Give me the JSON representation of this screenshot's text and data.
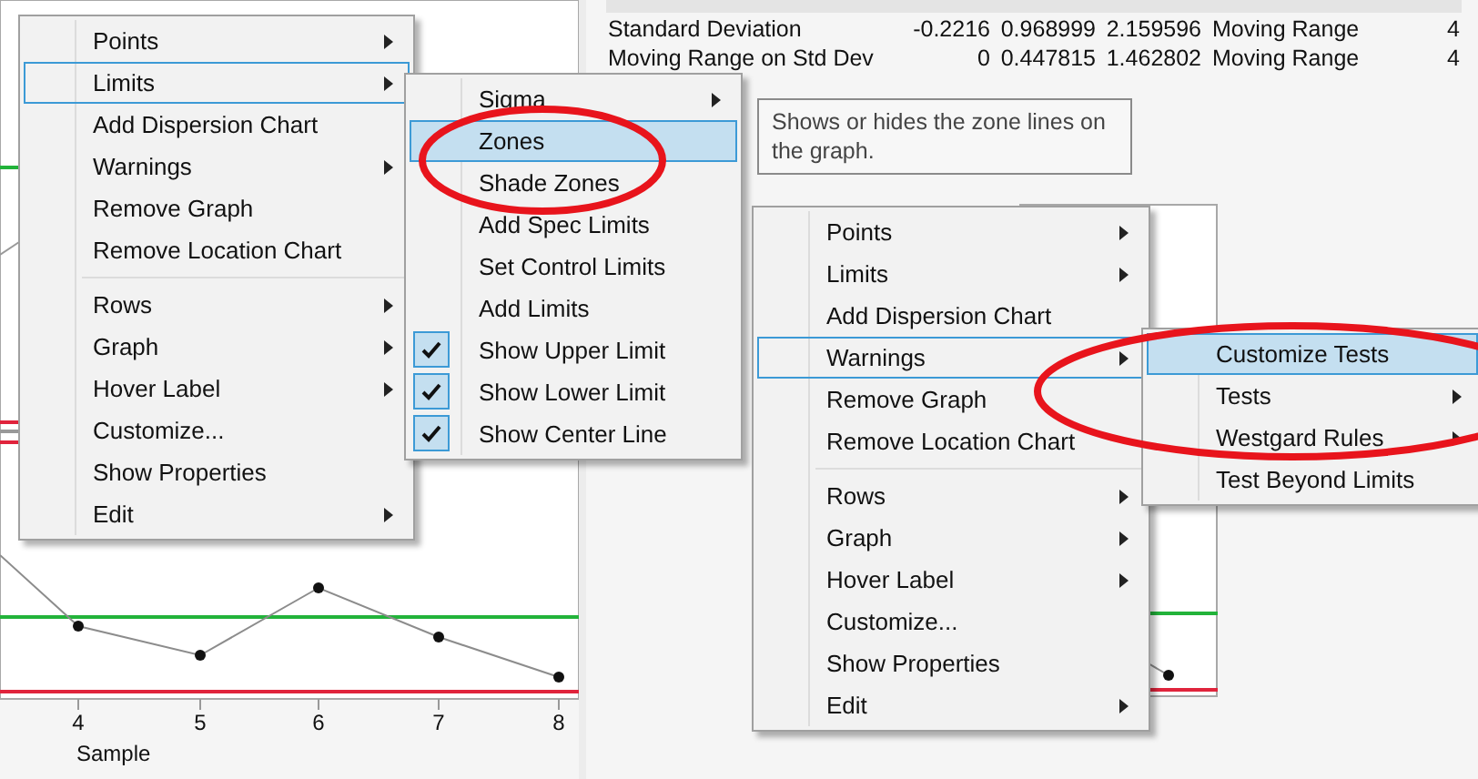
{
  "table": {
    "rows": [
      {
        "cells": [
          "Standard Deviation",
          "-0.2216",
          "0.968999",
          "2.159596",
          "Moving Range",
          "4"
        ]
      },
      {
        "cells": [
          "Moving Range on Std Dev",
          "0",
          "0.447815",
          "1.462802",
          "Moving Range",
          "4"
        ]
      }
    ]
  },
  "tooltip": "Shows or hides the zone lines on the graph.",
  "chart": {
    "x_tick_labels": [
      "4",
      "5",
      "6",
      "7",
      "8"
    ],
    "x_label": "Sample"
  },
  "context_menus": [
    {
      "items": [
        {
          "kind": "item",
          "label": "Points",
          "has_submenu": true,
          "selected": false,
          "expanded": false
        },
        {
          "kind": "item",
          "label": "Limits",
          "has_submenu": true,
          "selected": false,
          "expanded": true
        },
        {
          "kind": "item",
          "label": "Add Dispersion Chart",
          "has_submenu": false,
          "selected": false,
          "expanded": false
        },
        {
          "kind": "item",
          "label": "Warnings",
          "has_submenu": true,
          "selected": false,
          "expanded": false
        },
        {
          "kind": "item",
          "label": "Remove Graph",
          "has_submenu": false,
          "selected": false,
          "expanded": false
        },
        {
          "kind": "item",
          "label": "Remove Location Chart",
          "has_submenu": false,
          "selected": false,
          "expanded": false
        },
        {
          "kind": "separator"
        },
        {
          "kind": "item",
          "label": "Rows",
          "has_submenu": true,
          "selected": false,
          "expanded": false
        },
        {
          "kind": "item",
          "label": "Graph",
          "has_submenu": true,
          "selected": false,
          "expanded": false
        },
        {
          "kind": "item",
          "label": "Hover Label",
          "has_submenu": true,
          "selected": false,
          "expanded": false
        },
        {
          "kind": "item",
          "label": "Customize...",
          "has_submenu": false,
          "selected": false,
          "expanded": false
        },
        {
          "kind": "item",
          "label": "Show Properties",
          "has_submenu": false,
          "selected": false,
          "expanded": false
        },
        {
          "kind": "item",
          "label": "Edit",
          "has_submenu": true,
          "selected": false,
          "expanded": false
        }
      ]
    },
    {
      "items": [
        {
          "kind": "item",
          "label": "Sigma",
          "has_submenu": true,
          "selected": false,
          "expanded": false,
          "checked": false
        },
        {
          "kind": "item",
          "label": "Zones",
          "has_submenu": false,
          "selected": true,
          "expanded": false,
          "checked": false
        },
        {
          "kind": "item",
          "label": "Shade Zones",
          "has_submenu": false,
          "selected": false,
          "expanded": false,
          "checked": false
        },
        {
          "kind": "item",
          "label": "Add Spec Limits",
          "has_submenu": false,
          "selected": false,
          "expanded": false,
          "checked": false
        },
        {
          "kind": "item",
          "label": "Set Control Limits",
          "has_submenu": false,
          "selected": false,
          "expanded": false,
          "checked": false
        },
        {
          "kind": "item",
          "label": "Add Limits",
          "has_submenu": false,
          "selected": false,
          "expanded": false,
          "checked": false
        },
        {
          "kind": "item",
          "label": "Show Upper Limit",
          "has_submenu": false,
          "selected": false,
          "expanded": false,
          "checked": true
        },
        {
          "kind": "item",
          "label": "Show Lower Limit",
          "has_submenu": false,
          "selected": false,
          "expanded": false,
          "checked": true
        },
        {
          "kind": "item",
          "label": "Show Center Line",
          "has_submenu": false,
          "selected": false,
          "expanded": false,
          "checked": true
        }
      ]
    },
    {
      "items": [
        {
          "kind": "item",
          "label": "Points",
          "has_submenu": true,
          "selected": false,
          "expanded": false
        },
        {
          "kind": "item",
          "label": "Limits",
          "has_submenu": true,
          "selected": false,
          "expanded": false
        },
        {
          "kind": "item",
          "label": "Add Dispersion Chart",
          "has_submenu": false,
          "selected": false,
          "expanded": false
        },
        {
          "kind": "item",
          "label": "Warnings",
          "has_submenu": true,
          "selected": false,
          "expanded": true
        },
        {
          "kind": "item",
          "label": "Remove Graph",
          "has_submenu": false,
          "selected": false,
          "expanded": false
        },
        {
          "kind": "item",
          "label": "Remove Location Chart",
          "has_submenu": false,
          "selected": false,
          "expanded": false
        },
        {
          "kind": "separator"
        },
        {
          "kind": "item",
          "label": "Rows",
          "has_submenu": true,
          "selected": false,
          "expanded": false
        },
        {
          "kind": "item",
          "label": "Graph",
          "has_submenu": true,
          "selected": false,
          "expanded": false
        },
        {
          "kind": "item",
          "label": "Hover Label",
          "has_submenu": true,
          "selected": false,
          "expanded": false
        },
        {
          "kind": "item",
          "label": "Customize...",
          "has_submenu": false,
          "selected": false,
          "expanded": false
        },
        {
          "kind": "item",
          "label": "Show Properties",
          "has_submenu": false,
          "selected": false,
          "expanded": false
        },
        {
          "kind": "item",
          "label": "Edit",
          "has_submenu": true,
          "selected": false,
          "expanded": false
        }
      ]
    },
    {
      "items": [
        {
          "kind": "item",
          "label": "Customize Tests",
          "has_submenu": false,
          "selected": true,
          "expanded": false
        },
        {
          "kind": "item",
          "label": "Tests",
          "has_submenu": true,
          "selected": false,
          "expanded": false
        },
        {
          "kind": "item",
          "label": "Westgard Rules",
          "has_submenu": true,
          "selected": false,
          "expanded": false
        },
        {
          "kind": "item",
          "label": "Test Beyond Limits",
          "has_submenu": false,
          "selected": false,
          "expanded": false
        }
      ]
    }
  ]
}
